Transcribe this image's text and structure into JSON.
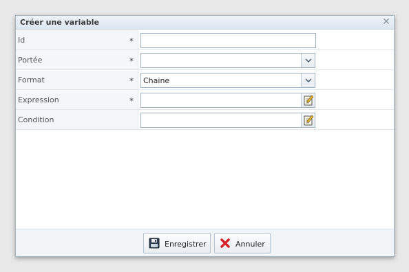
{
  "dialog": {
    "title": "Créer une variable",
    "close_icon": "close-icon"
  },
  "fields": [
    {
      "label": "Id",
      "required": "*",
      "type": "text",
      "value": ""
    },
    {
      "label": "Portée",
      "required": "*",
      "type": "combo",
      "value": ""
    },
    {
      "label": "Format",
      "required": "*",
      "type": "combo",
      "value": "Chaine"
    },
    {
      "label": "Expression",
      "required": "*",
      "type": "text-edit",
      "value": ""
    },
    {
      "label": "Condition",
      "required": "",
      "type": "text-edit",
      "value": ""
    }
  ],
  "buttons": {
    "save_label": "Enregistrer",
    "save_icon": "floppy-disk-icon",
    "cancel_label": "Annuler",
    "cancel_icon": "red-x-icon"
  },
  "colors": {
    "titlebar": "#dce6f0",
    "border": "#9fb0c2",
    "cancel_red": "#d8232a"
  }
}
